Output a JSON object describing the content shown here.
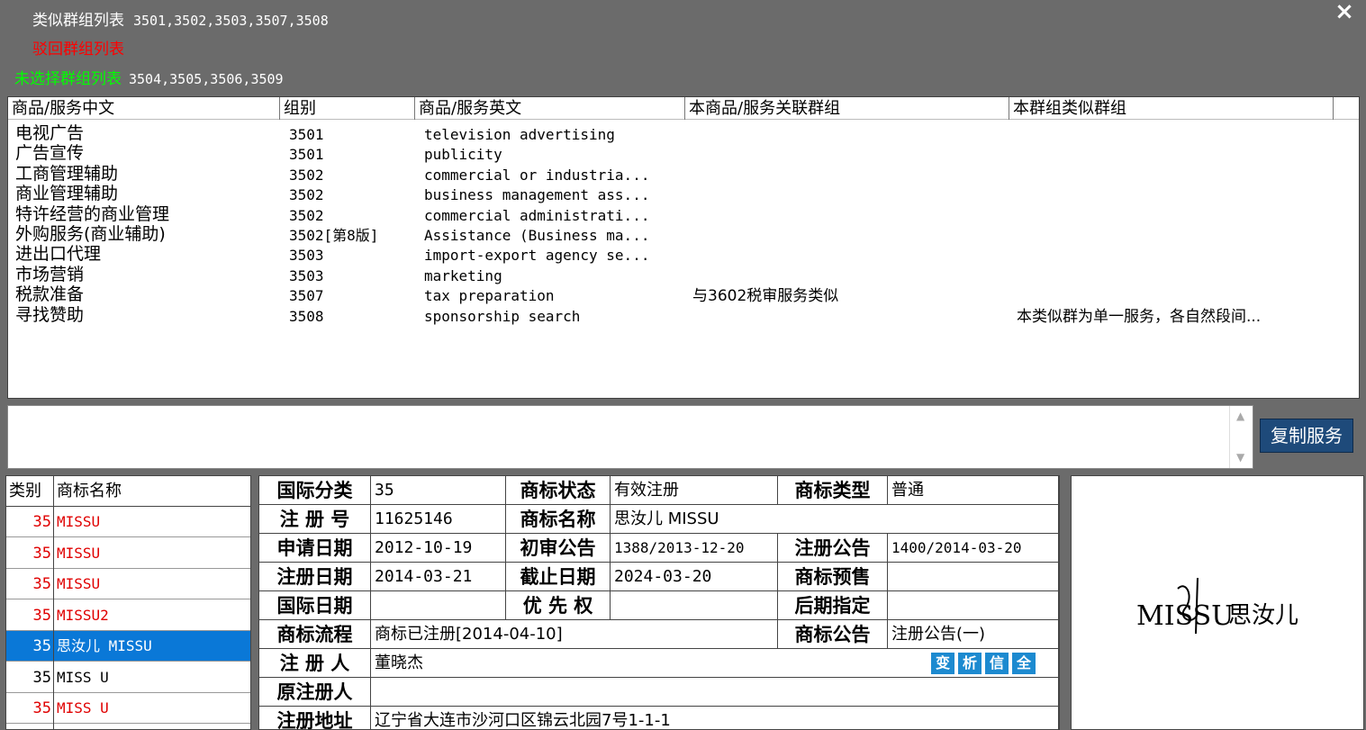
{
  "header": {
    "similar_label": "类似群组列表",
    "similar_nums": "3501,3502,3503,3507,3508",
    "rejected_label": "驳回群组列表",
    "unselected_label": "未选择群组列表",
    "unselected_nums": "3504,3505,3506,3509",
    "close_icon": "×"
  },
  "grid": {
    "columns": [
      "商品/服务中文",
      "组别",
      "商品/服务英文",
      "本商品/服务关联群组",
      "本群组类似群组"
    ],
    "rows": [
      {
        "cn": "电视广告",
        "grp": "3501",
        "en": "television advertising",
        "rel": "",
        "sim": ""
      },
      {
        "cn": "广告宣传",
        "grp": "3501",
        "en": "publicity",
        "rel": "",
        "sim": ""
      },
      {
        "cn": "工商管理辅助",
        "grp": "3502",
        "en": "commercial or industria...",
        "rel": "",
        "sim": ""
      },
      {
        "cn": "商业管理辅助",
        "grp": "3502",
        "en": "business management ass...",
        "rel": "",
        "sim": ""
      },
      {
        "cn": "特许经营的商业管理",
        "grp": "3502",
        "en": "commercial administrati...",
        "rel": "",
        "sim": ""
      },
      {
        "cn": "外购服务(商业辅助)",
        "grp": "3502[第8版]",
        "en": "Assistance (Business ma...",
        "rel": "",
        "sim": ""
      },
      {
        "cn": "进出口代理",
        "grp": "3503",
        "en": "import-export agency se...",
        "rel": "",
        "sim": ""
      },
      {
        "cn": "市场营销",
        "grp": "3503",
        "en": "marketing",
        "rel": "",
        "sim": ""
      },
      {
        "cn": "税款准备",
        "grp": "3507",
        "en": "tax preparation",
        "rel": "与3602税审服务类似",
        "sim": ""
      },
      {
        "cn": "寻找赞助",
        "grp": "3508",
        "en": "sponsorship search",
        "rel": "",
        "sim": "本类似群为单一服务，各自然段间..."
      }
    ]
  },
  "memo": {
    "value": "",
    "scroll_up": "▲",
    "scroll_down": "▼"
  },
  "copy_button": "复制服务",
  "tm_list": {
    "headers": [
      "类别",
      "商标名称"
    ],
    "items": [
      {
        "cls": "35",
        "name": "MISSU",
        "style": "red"
      },
      {
        "cls": "35",
        "name": "MISSU",
        "style": "red"
      },
      {
        "cls": "35",
        "name": "MISSU",
        "style": "red"
      },
      {
        "cls": "35",
        "name": "MISSU2",
        "style": "red"
      },
      {
        "cls": "35",
        "name": "思汝儿 MISSU",
        "style": "sel"
      },
      {
        "cls": "35",
        "name": "MISS U",
        "style": "black"
      },
      {
        "cls": "35",
        "name": "MISS U",
        "style": "red"
      }
    ]
  },
  "info": {
    "intl_class_label": "国际分类",
    "intl_class": "35",
    "status_label": "商标状态",
    "status": "有效注册",
    "type_label": "商标类型",
    "type": "普通",
    "regno_label": "注 册 号",
    "regno": "11625146",
    "name_label": "商标名称",
    "name": " 思汝儿 MISSU",
    "apply_date_label": "申请日期",
    "apply_date": "2012-10-19",
    "prelim_label": "初审公告",
    "prelim": "1388/2013-12-20",
    "reg_notice_label": "注册公告",
    "reg_notice": "1400/2014-03-20",
    "reg_date_label": "注册日期",
    "reg_date": "2014-03-21",
    "expire_label": "截止日期",
    "expire": "2024-03-20",
    "presale_label": "商标预售",
    "presale": "",
    "intl_date_label": "国际日期",
    "intl_date": "",
    "priority_label": "优 先 权",
    "priority": "",
    "later_label": "后期指定",
    "later": "",
    "flow_label": "商标流程",
    "flow": "商标已注册[2014-04-10]",
    "gazette_label": "商标公告",
    "gazette": "注册公告(一)",
    "registrant_label": "注 册 人",
    "registrant": "董晓杰",
    "orig_registrant_label": "原注册人",
    "orig_registrant": "",
    "address_label": "注册地址",
    "address": "辽宁省大连市沙河口区锦云北园7号1-1-1",
    "buttons": [
      "变",
      "析",
      "信",
      "全"
    ]
  },
  "logo": {
    "latin": "MISSU",
    "chinese": "思汝儿"
  },
  "colors": {
    "bg": "#6b6b6b",
    "red": "#ff0000",
    "green": "#00ff00",
    "selected": "#0a78d7",
    "button": "#1e4a7a"
  }
}
